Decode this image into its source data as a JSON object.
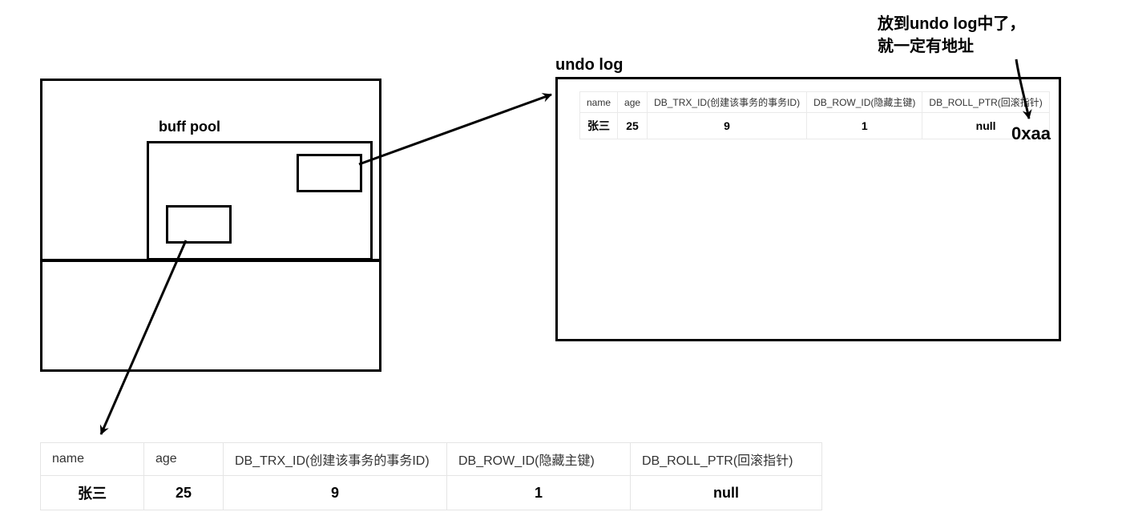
{
  "labels": {
    "buff_pool": "buff pool",
    "undo_log": "undo log",
    "annotation_line1": "放到undo log中了，",
    "annotation_line2": "就一定有地址",
    "address": "0xaa"
  },
  "columns": {
    "name": "name",
    "age": "age",
    "trx": "DB_TRX_ID(创建该事务的事务ID)",
    "row": "DB_ROW_ID(隐藏主键)",
    "roll": "DB_ROLL_PTR(回滚指针)"
  },
  "row": {
    "name": "张三",
    "age": "25",
    "trx": "9",
    "row": "1",
    "roll": "null"
  }
}
